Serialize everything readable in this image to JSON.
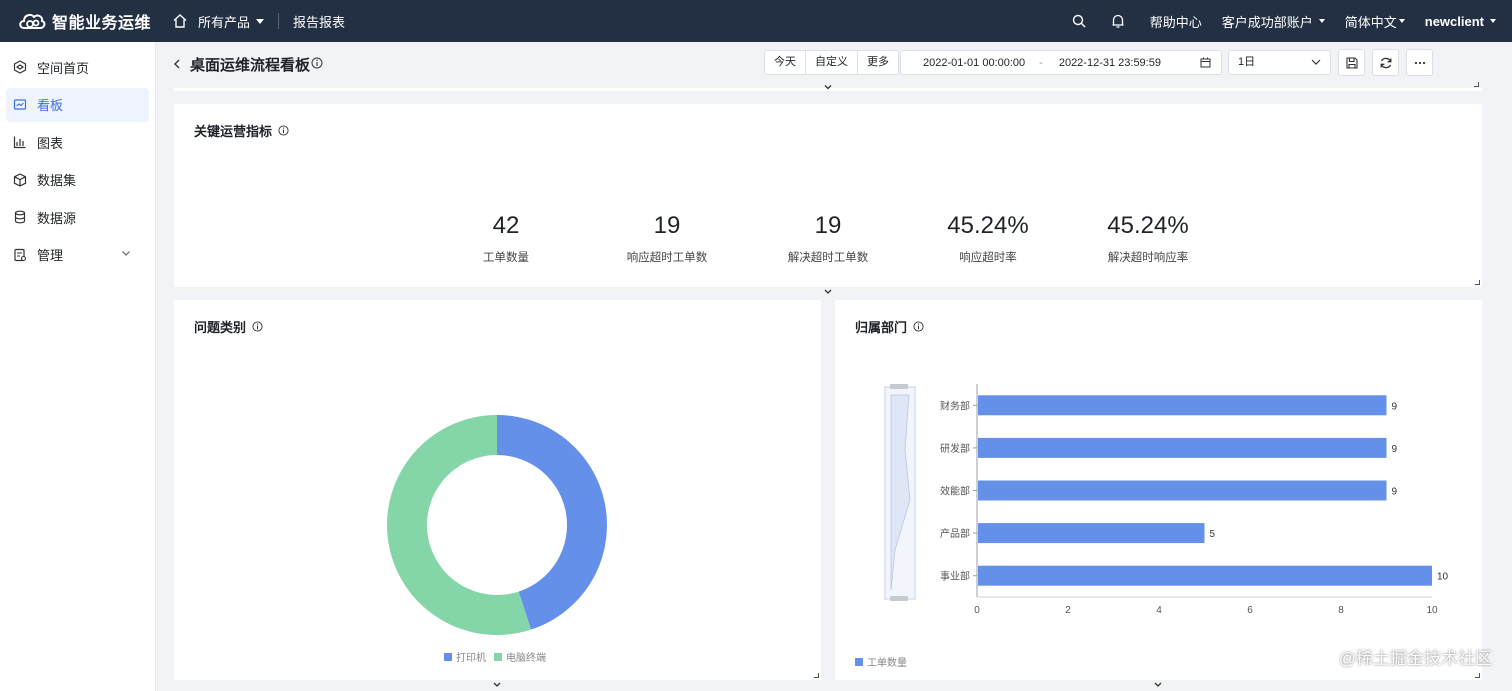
{
  "topbar": {
    "brand": "智能业务运维",
    "products_label": "所有产品",
    "report_label": "报告报表",
    "help_label": "帮助中心",
    "account_label": "客户成功部账户",
    "language_label": "简体中文",
    "user_label": "newclient"
  },
  "sidebar": {
    "items": [
      {
        "label": "空间首页",
        "icon": "space-home-icon"
      },
      {
        "label": "看板",
        "icon": "dashboard-icon",
        "active": true
      },
      {
        "label": "图表",
        "icon": "chart-icon"
      },
      {
        "label": "数据集",
        "icon": "dataset-icon"
      },
      {
        "label": "数据源",
        "icon": "datasource-icon"
      },
      {
        "label": "管理",
        "icon": "manage-icon"
      }
    ]
  },
  "header": {
    "title": "桌面运维流程看板",
    "quick_buttons": [
      "今天",
      "自定义",
      "更多"
    ],
    "date_start": "2022-01-01 00:00:00",
    "date_separator": "-",
    "date_end": "2022-12-31 23:59:59",
    "granularity": "1日"
  },
  "kpi_card": {
    "title": "关键运营指标",
    "items": [
      {
        "value": "42",
        "label": "工单数量"
      },
      {
        "value": "19",
        "label": "响应超时工单数"
      },
      {
        "value": "19",
        "label": "解决超时工单数"
      },
      {
        "value": "45.24%",
        "label": "响应超时率"
      },
      {
        "value": "45.24%",
        "label": "解决超时响应率"
      }
    ]
  },
  "pie_card": {
    "title": "问题类别"
  },
  "bar_card": {
    "title": "归属部门"
  },
  "chart_data": [
    {
      "type": "pie",
      "donut": true,
      "categories": [
        "打印机",
        "电脑终端"
      ],
      "values": [
        0.45,
        0.55
      ],
      "colors": [
        "#6590ea",
        "#84d6a8"
      ],
      "legend": "bottom"
    },
    {
      "type": "bar",
      "orientation": "horizontal",
      "categories": [
        "财务部",
        "研发部",
        "效能部",
        "产品部",
        "事业部"
      ],
      "series": [
        {
          "name": "工单数量",
          "values": [
            9,
            9,
            9,
            5,
            10
          ]
        }
      ],
      "xticks": [
        "0",
        "2",
        "4",
        "6",
        "8",
        "10"
      ],
      "xlim": [
        0,
        10
      ],
      "color": "#6590ea",
      "legend": "bottom-left"
    }
  ],
  "watermark": "@稀土掘金技术社区"
}
